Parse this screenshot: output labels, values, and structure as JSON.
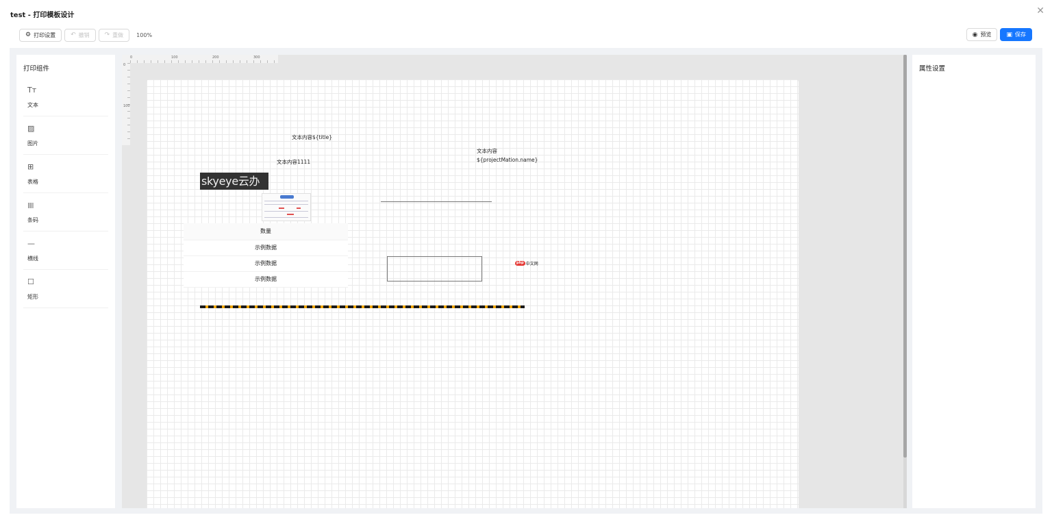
{
  "window": {
    "title": "test - 打印模板设计",
    "close_glyph": "✕"
  },
  "toolbar": {
    "print_settings": "打印设置",
    "undo": "撤销",
    "redo": "重做",
    "zoom": "100%",
    "preview": "预览",
    "save": "保存",
    "icons": {
      "print_settings": "gear-icon",
      "undo": "undo-icon",
      "redo": "redo-icon",
      "preview": "eye-icon",
      "save": "save-icon"
    }
  },
  "left_panel": {
    "title": "打印组件",
    "components": [
      {
        "label": "文本",
        "icon": "text-icon",
        "glyph": "Tт"
      },
      {
        "label": "图片",
        "icon": "image-icon",
        "glyph": "▨"
      },
      {
        "label": "表格",
        "icon": "table-icon",
        "glyph": "⊞"
      },
      {
        "label": "条码",
        "icon": "barcode-icon",
        "glyph": "|||||"
      },
      {
        "label": "横线",
        "icon": "line-icon",
        "glyph": "—"
      },
      {
        "label": "矩形",
        "icon": "rectangle-icon",
        "glyph": "☐"
      }
    ]
  },
  "right_panel": {
    "title": "属性设置"
  },
  "ruler": {
    "h_labels": [
      "0",
      "100",
      "200",
      "300"
    ],
    "v_labels": [
      "0",
      "100"
    ]
  },
  "canvas": {
    "text1": "文本内容${title}",
    "text2": "文本内容1111",
    "text3_line1": "文本内容",
    "text3_line2": "${projectMation.name}",
    "logo_text": "skyeye云办公",
    "php_badge": "php",
    "php_text": "中文网",
    "table": {
      "header": "数量",
      "rows": [
        "示例数据",
        "示例数据",
        "示例数据"
      ]
    },
    "colors": {
      "dash_primary": "#1a1a1a",
      "dash_secondary": "#f0a500",
      "accent": "#1677ff"
    }
  }
}
